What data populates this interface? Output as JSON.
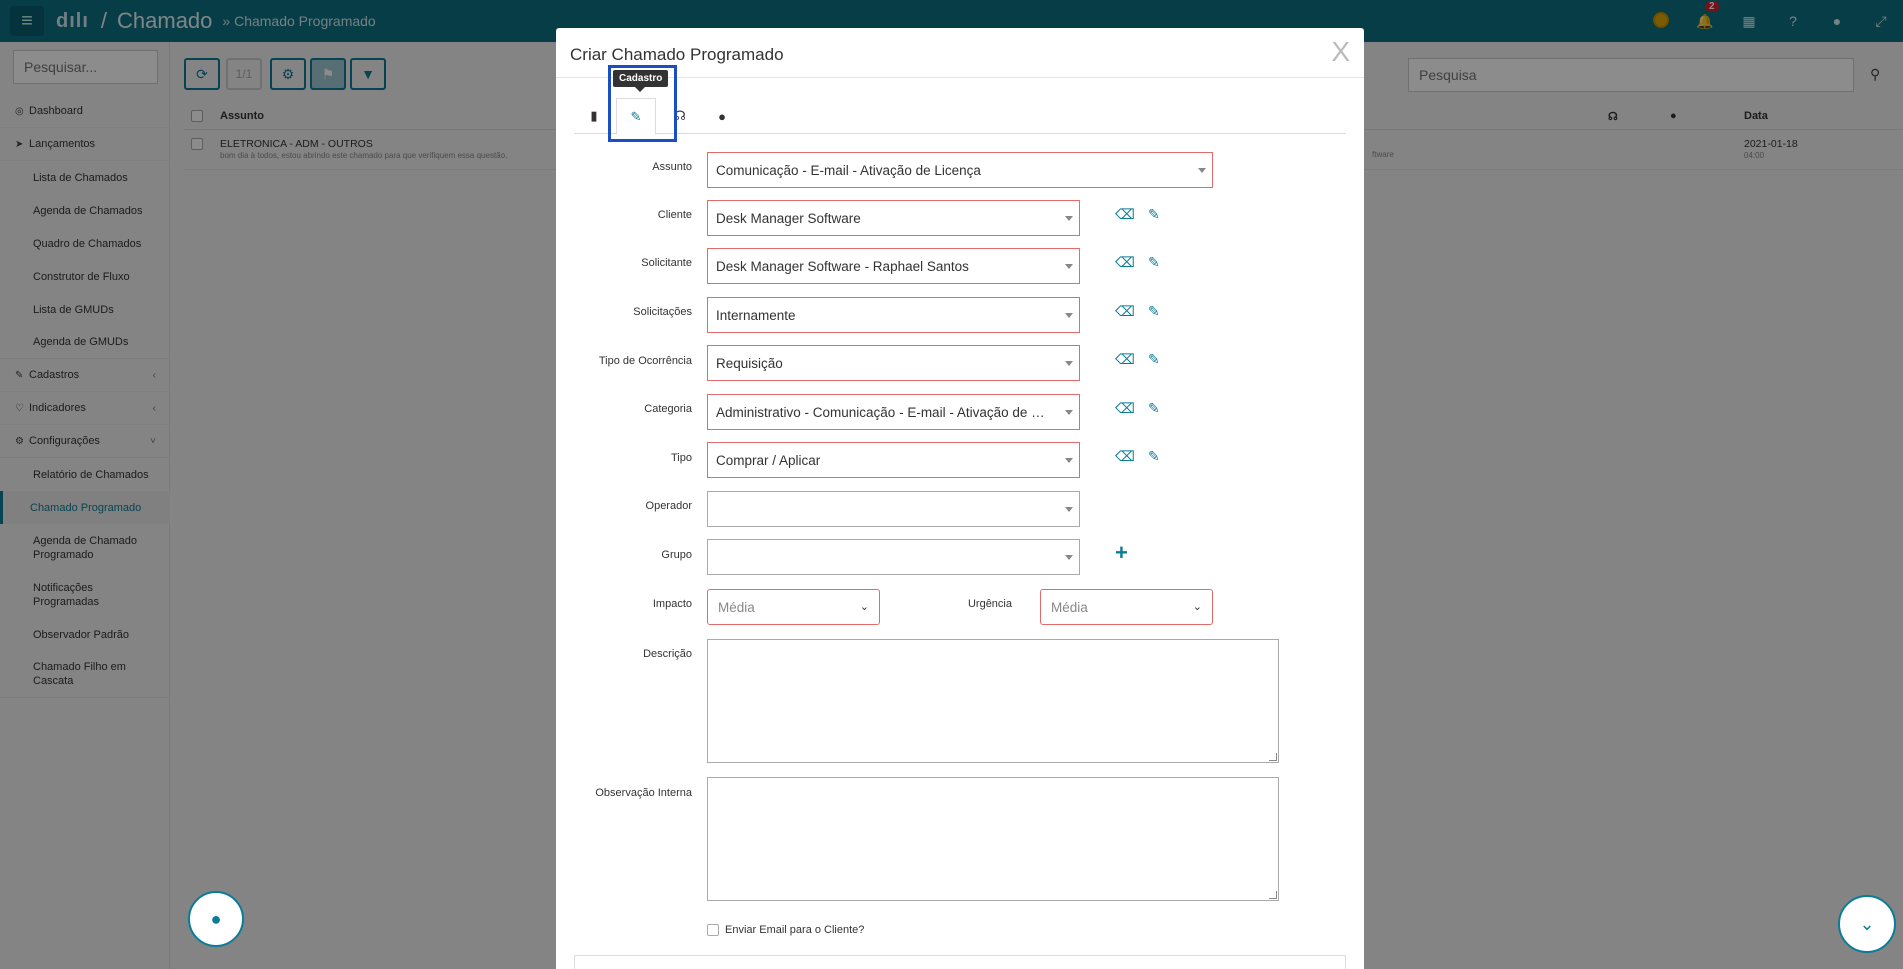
{
  "topbar": {
    "logo": "dılı",
    "slash": "/",
    "title": "Chamado",
    "breadcrumb": "» Chamado Programado",
    "notification_count": "2"
  },
  "sidebar": {
    "search_placeholder": "Pesquisar...",
    "items": {
      "dashboard": "Dashboard",
      "lancamentos": "Lançamentos",
      "lista_chamados": "Lista de Chamados",
      "agenda_chamados": "Agenda de Chamados",
      "quadro_chamados": "Quadro de Chamados",
      "construtor_fluxo": "Construtor de Fluxo",
      "lista_gmuds": "Lista de GMUDs",
      "agenda_gmuds": "Agenda de GMUDs",
      "cadastros": "Cadastros",
      "indicadores": "Indicadores",
      "configuracoes": "Configurações",
      "relatorio_chamados": "Relatório de Chamados",
      "chamado_programado": "Chamado Programado",
      "agenda_chamado_programado": "Agenda de Chamado Programado",
      "notificacoes_programadas": "Notificações Programadas",
      "observador_padrao": "Observador Padrão",
      "chamado_filho_cascata": "Chamado Filho em Cascata"
    }
  },
  "toolbar": {
    "pager": "1/1",
    "search_placeholder": "Pesquisa"
  },
  "grid": {
    "headers": {
      "assunto": "Assunto",
      "data": "Data"
    },
    "rows": [
      {
        "assunto": "ELETRONICA - ADM - OUTROS",
        "descricao": "bom dia à todos, estou abrindo este chamado para que verifiquem essa questão.",
        "trailing": "ftware",
        "data": "2021-01-18",
        "hora": "04:00"
      }
    ]
  },
  "modal": {
    "title": "Criar Chamado Programado",
    "close": "X",
    "tooltip": "Cadastro",
    "fields": {
      "assunto": {
        "label": "Assunto",
        "value": "Comunicação - E-mail - Ativação de Licença"
      },
      "cliente": {
        "label": "Cliente",
        "value": "Desk Manager Software"
      },
      "solicitante": {
        "label": "Solicitante",
        "value": "Desk Manager Software - Raphael Santos"
      },
      "solicitacoes": {
        "label": "Solicitações",
        "value": "Internamente"
      },
      "tipo_ocorrencia": {
        "label": "Tipo de Ocorrência",
        "value": "Requisição"
      },
      "categoria": {
        "label": "Categoria",
        "value": "Administrativo - Comunicação - E-mail - Ativação de Licença"
      },
      "tipo": {
        "label": "Tipo",
        "value": "Comprar / Aplicar"
      },
      "operador": {
        "label": "Operador",
        "value": ""
      },
      "grupo": {
        "label": "Grupo",
        "value": ""
      },
      "impacto": {
        "label": "Impacto",
        "value": "Média"
      },
      "urgencia": {
        "label": "Urgência",
        "value": "Média"
      },
      "descricao": {
        "label": "Descrição"
      },
      "observacao": {
        "label": "Observação Interna"
      }
    },
    "enviar_email": "Enviar Email para o Cliente?"
  },
  "colors": {
    "teal": "#0b6f82",
    "accent": "#0b7c97",
    "error_border": "#e46a6a",
    "highlight": "#1a4fc4"
  }
}
